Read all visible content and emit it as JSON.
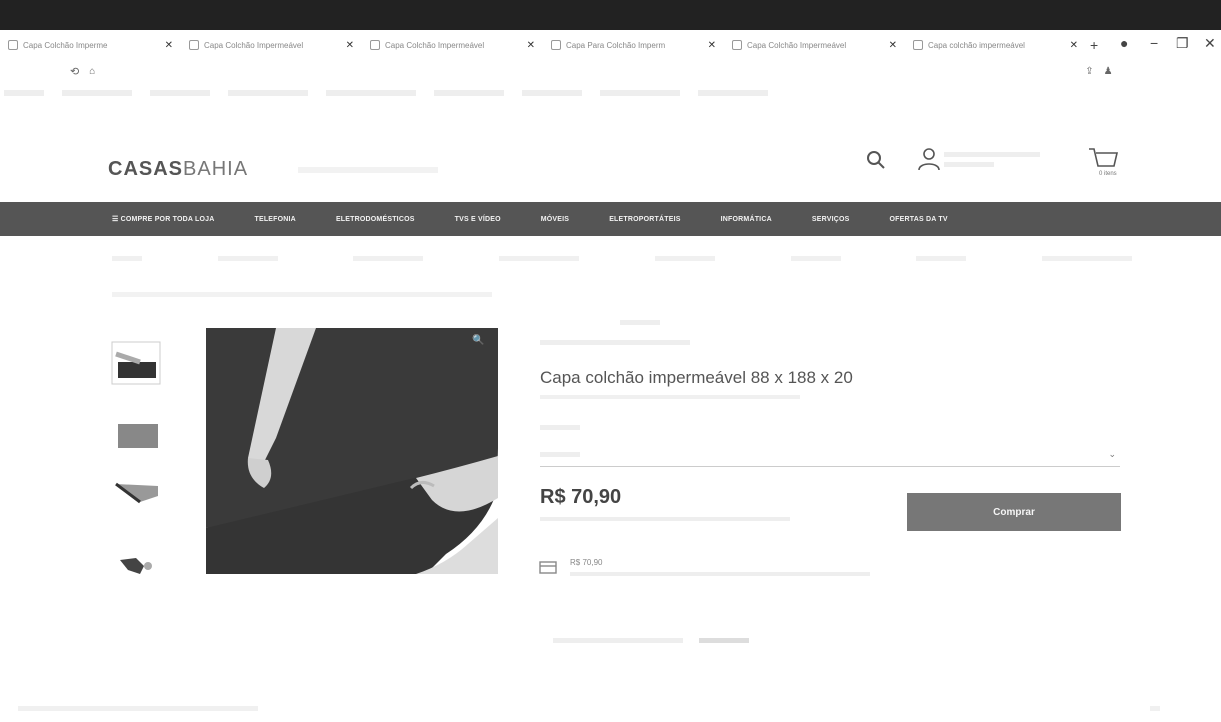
{
  "browser": {
    "tabs": [
      {
        "label": "Capa Colchão Imperme"
      },
      {
        "label": "Capa Colchão Impermeável"
      },
      {
        "label": "Capa Colchão Impermeável"
      },
      {
        "label": "Capa Para Colchão Imperm"
      },
      {
        "label": "Capa Colchão Impermeável"
      },
      {
        "label": "Capa colchão impermeável"
      }
    ],
    "new_tab": "+",
    "minimize": "−",
    "restore": "❐",
    "close": "✕"
  },
  "site": {
    "logo_bold": "CASAS",
    "logo_light": "BAHIA",
    "cart_label": "0 itens"
  },
  "nav": {
    "categories": [
      "☰ COMPRE POR TODA LOJA",
      "TELEFONIA",
      "ELETRODOMÉSTICOS",
      "TVS E VÍDEO",
      "MÓVEIS",
      "ELETROPORTÁTEIS",
      "INFORMÁTICA",
      "SERVIÇOS",
      "OFERTAS DA TV"
    ]
  },
  "product": {
    "title": "Capa colchão impermeável 88 x 188 x 20",
    "price": "R$ 70,90",
    "card_price": "R$ 70,90",
    "buy_label": "Comprar",
    "zoom_label": "🔍"
  },
  "colors": {
    "nav_bg": "#555555",
    "buy_bg": "#777777",
    "header_bar": "#222222"
  }
}
